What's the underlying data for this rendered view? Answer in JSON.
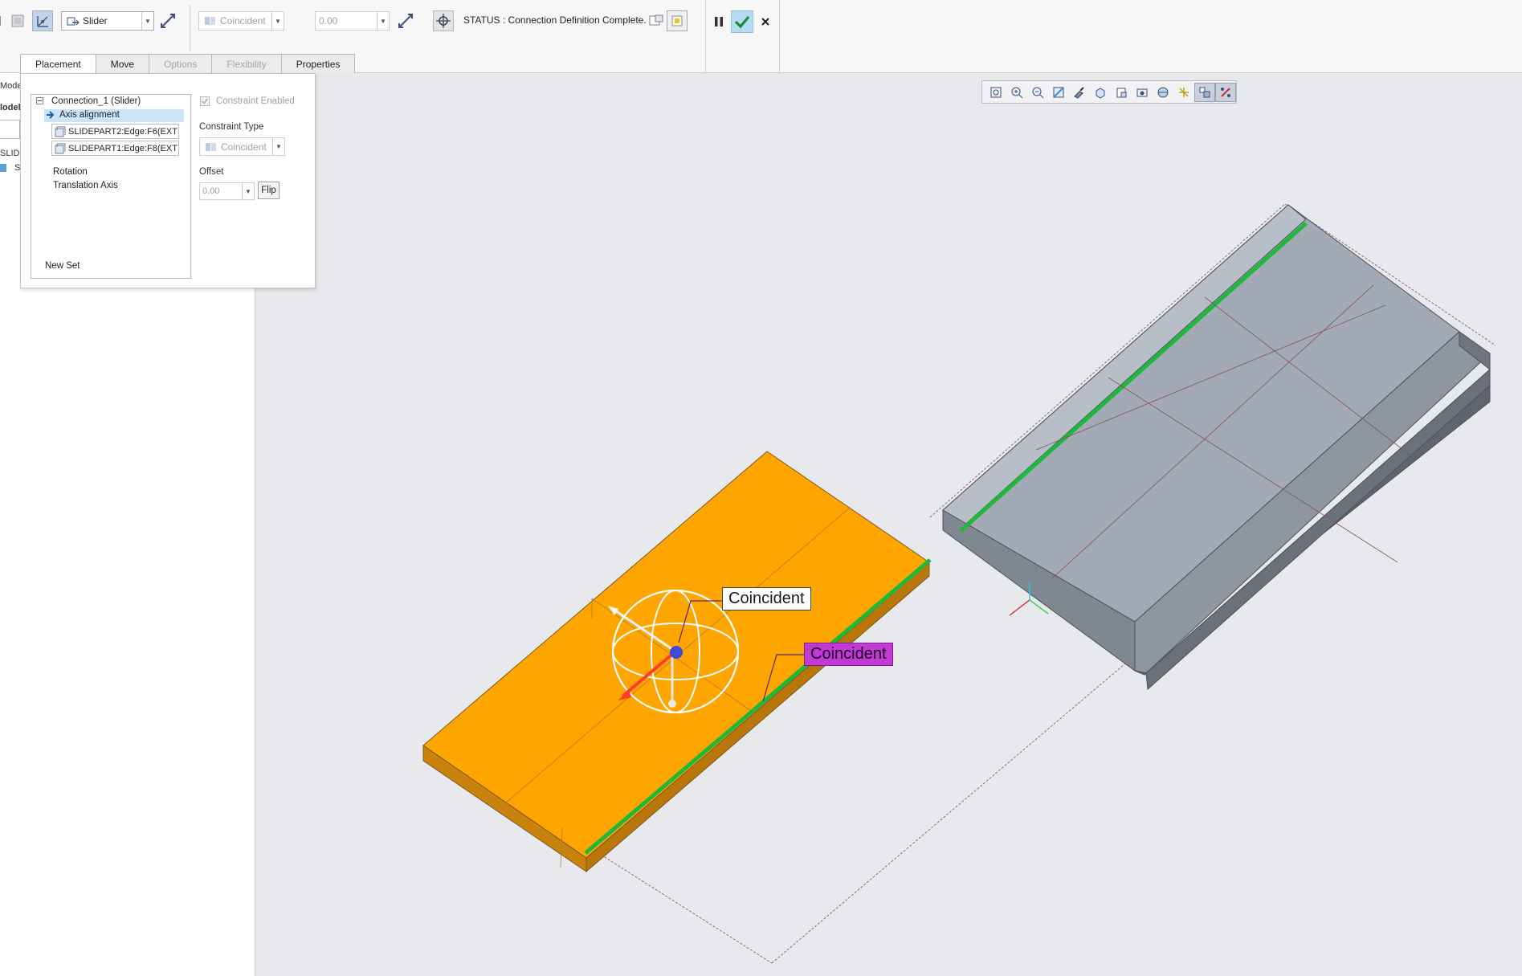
{
  "toolbar": {
    "connection_type": "Slider",
    "constraint_type": "Coincident",
    "offset_value": "0.00",
    "status_text": "STATUS : Connection Definition Complete."
  },
  "tabs": [
    {
      "label": "Placement",
      "state": "active"
    },
    {
      "label": "Move",
      "state": "normal"
    },
    {
      "label": "Options",
      "state": "disabled"
    },
    {
      "label": "Flexibility",
      "state": "disabled"
    },
    {
      "label": "Properties",
      "state": "normal"
    }
  ],
  "left_pane": {
    "partial_labels": [
      "Mode",
      "lodel",
      "SLIDE",
      "S"
    ]
  },
  "placement": {
    "tree": {
      "connection": "Connection_1 (Slider)",
      "constraint": "Axis alignment",
      "references": [
        "SLIDEPART2:Edge:F6(EXT",
        "SLIDEPART1:Edge:F8(EXT"
      ],
      "items": [
        "Rotation",
        "Translation Axis"
      ],
      "new_set": "New Set"
    },
    "constraint_enabled_label": "Constraint Enabled",
    "constraint_type_label": "Constraint Type",
    "constraint_type_value": "Coincident",
    "offset_label": "Offset",
    "offset_value": "0.00",
    "flip_label": "Flip"
  },
  "viewport": {
    "annotations": [
      {
        "label": "Coincident",
        "style": "white"
      },
      {
        "label": "Coincident",
        "style": "magenta"
      }
    ],
    "colors": {
      "background": "#e8e9ec",
      "part_orange": "#ffa500",
      "part_gray": "#9aa3ae",
      "edge_green": "#1eb83a",
      "annotation_magenta": "#c23ad6"
    },
    "view_toolbar_icons": [
      "refit-icon",
      "zoom-in-icon",
      "zoom-out-icon",
      "repaint-icon",
      "shading-icon",
      "saved-views-icon",
      "display-style-icon",
      "perspective-icon",
      "appearance-icon",
      "datum-display-icon",
      "spin-center-icon",
      "annotation-display-icon"
    ]
  },
  "actions": {
    "pause_icon": "pause-icon",
    "ok_icon": "check-icon",
    "cancel_icon": "close-icon"
  }
}
